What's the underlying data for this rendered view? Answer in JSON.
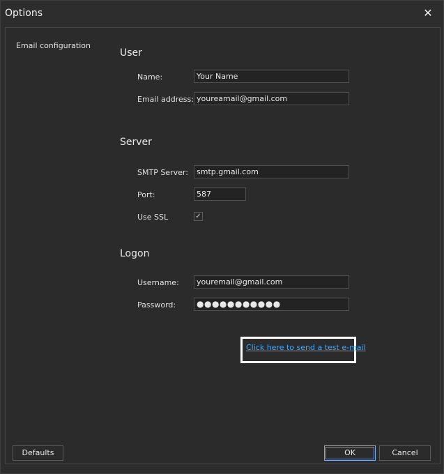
{
  "window": {
    "title": "Options",
    "close_glyph": "✕"
  },
  "nav": {
    "items": [
      {
        "label": "Email configuration"
      }
    ]
  },
  "sections": {
    "user": {
      "title": "User",
      "name_label": "Name:",
      "name_value": "Your Name",
      "email_label": "Email address:",
      "email_value": "youreamail@gmail.com"
    },
    "server": {
      "title": "Server",
      "smtp_label": "SMTP Server:",
      "smtp_value": "smtp.gmail.com",
      "port_label": "Port:",
      "port_value": "587",
      "ssl_label": "Use SSL",
      "ssl_checked": true,
      "ssl_check_glyph": "✓"
    },
    "logon": {
      "title": "Logon",
      "username_label": "Username:",
      "username_value": "youremail@gmail.com",
      "password_label": "Password:",
      "password_mask": "●●●●●●●●●●●"
    }
  },
  "test_link": "Click here to send a test e-mail",
  "buttons": {
    "defaults": "Defaults",
    "ok": "OK",
    "cancel": "Cancel"
  },
  "icons": {
    "close": "close-icon",
    "check": "check-icon"
  }
}
